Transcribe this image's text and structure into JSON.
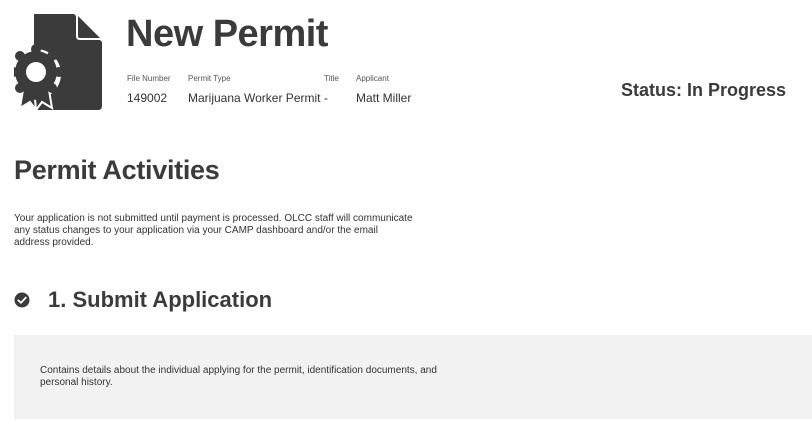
{
  "header": {
    "title": "New Permit",
    "icon": "permit-document-award-icon",
    "meta": {
      "file_number_label": "File Number",
      "file_number": "149002",
      "permit_type_label": "Permit Type",
      "permit_type": "Marijuana Worker Permit",
      "title_label": "Title",
      "title_value": "-",
      "applicant_label": "Applicant",
      "applicant": "Matt Miller"
    },
    "status": "Status: In Progress"
  },
  "activities": {
    "heading": "Permit Activities",
    "intro": "Your application is not submitted until payment is processed. OLCC staff will communicate any status changes to your application via your CAMP dashboard and/or the email address provided.",
    "steps": [
      {
        "icon": "check-circle-icon",
        "title": "1. Submit Application",
        "description": "Contains details about the individual applying for the permit, identification documents, and personal history."
      }
    ]
  },
  "colors": {
    "icon": "#3b3b3b",
    "panel_bg": "#f2f2f2",
    "text": "#333333"
  }
}
